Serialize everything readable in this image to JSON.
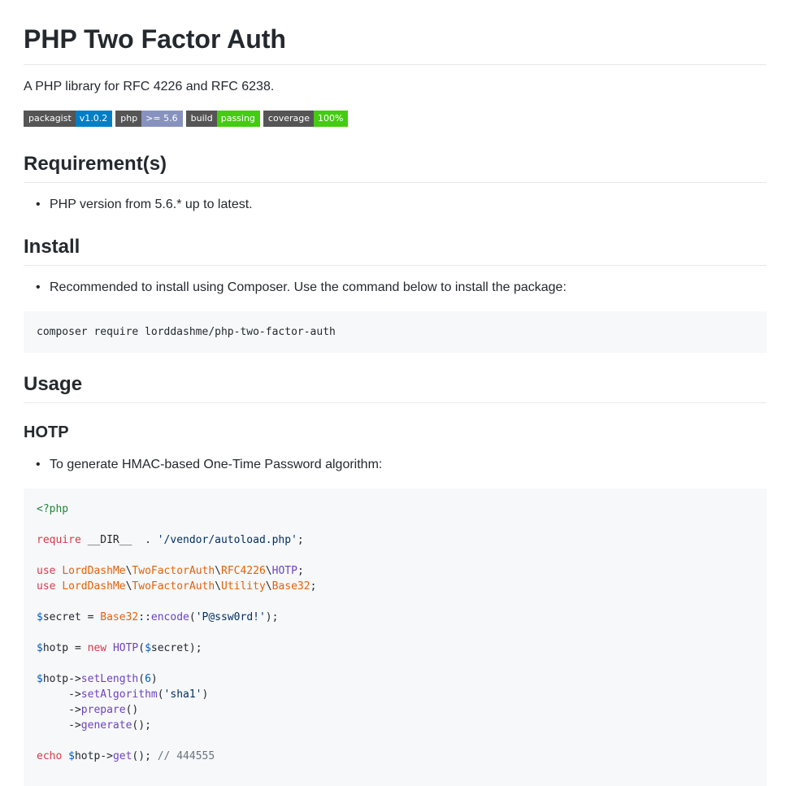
{
  "title": "PHP Two Factor Auth",
  "description": "A PHP library for RFC 4226 and RFC 6238.",
  "badges": [
    {
      "label": "packagist",
      "value": "v1.0.2",
      "color": "#007ec6"
    },
    {
      "label": "php",
      "value": ">= 5.6",
      "color": "#8892bf"
    },
    {
      "label": "build",
      "value": "passing",
      "color": "#44cc11"
    },
    {
      "label": "coverage",
      "value": "100%",
      "color": "#4c1"
    }
  ],
  "sections": {
    "requirements": {
      "heading": "Requirement(s)",
      "items": [
        "PHP version from 5.6.* up to latest."
      ]
    },
    "install": {
      "heading": "Install",
      "items": [
        "Recommended to install using Composer. Use the command below to install the package:"
      ],
      "command": "composer require lorddashme/php-two-factor-auth"
    },
    "usage": {
      "heading": "Usage",
      "hotp": {
        "heading": "HOTP",
        "items": [
          "To generate HMAC-based One-Time Password algorithm:"
        ]
      }
    }
  },
  "code": {
    "open_tag": "<?php",
    "require_kw": "require",
    "require_rest": " __DIR__  . ",
    "require_path": "'/vendor/autoload.php'",
    "use_kw": "use",
    "use1": [
      "LordDashMe",
      "TwoFactorAuth",
      "RFC4226",
      "HOTP"
    ],
    "use2": [
      "LordDashMe",
      "TwoFactorAuth",
      "Utility",
      "Base32"
    ],
    "secret_var": "$",
    "secret_name": "secret = ",
    "base32": "Base32",
    "encode": "encode",
    "password": "'P@ssw0rd!'",
    "hotp_name": "hotp = ",
    "new_kw": "new",
    "hotp_class": "HOTP",
    "secret_arg": "secret",
    "set_length": "setLength",
    "length": "6",
    "set_algorithm": "setAlgorithm",
    "algorithm": "'sha1'",
    "prepare": "prepare",
    "generate": "generate",
    "echo_kw": "echo",
    "get": "get",
    "comment": "// 444555"
  }
}
